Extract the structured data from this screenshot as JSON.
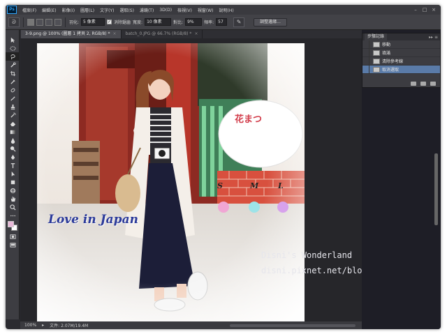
{
  "menubar": {
    "logo": "Ps",
    "items": [
      "檔案(F)",
      "編輯(E)",
      "影像(I)",
      "圖層(L)",
      "文字(Y)",
      "選取(S)",
      "濾鏡(T)",
      "3D(D)",
      "檢視(V)",
      "視窗(W)",
      "說明(H)"
    ]
  },
  "options": {
    "feather_label": "羽化:",
    "feather_value": "5 像素",
    "antialias_label": "消除鋸齒",
    "width_label": "寬度:",
    "width_value": "10 像素",
    "contrast_label": "對比:",
    "contrast_value": "9%",
    "frequency_label": "頻率:",
    "frequency_value": "57",
    "refine_edge": "調整邊緣..."
  },
  "tabs": [
    {
      "label": "3-9.png @ 100% (圖層 1 拷貝 2, RGB/8) *",
      "active": true
    },
    {
      "label": "batch_0.JPG @ 66.7% (RGB/8) *",
      "active": false
    }
  ],
  "history": {
    "title": "步驟記錄",
    "items": [
      "移動",
      "填滿",
      "清除參考線",
      "取消選取"
    ],
    "selected_index": 3
  },
  "status": {
    "zoom": "100%",
    "doc": "文件: 2.07M/19.4M"
  },
  "image_text": {
    "love": "Love in Japan",
    "wonderland": "Disni's Wonderland",
    "blog_url": "disni.pixnet.net/blog",
    "sign": "花まつ",
    "size_s": "S",
    "size_m": "M",
    "size_l": "L"
  },
  "colors": {
    "foreground": "#e9b9d9",
    "background": "#ffffff",
    "dot_pink": "#f0a6d4",
    "dot_teal": "#9de3e8",
    "dot_violet": "#d7a2ec",
    "history_selected": "#5a7ba8"
  }
}
